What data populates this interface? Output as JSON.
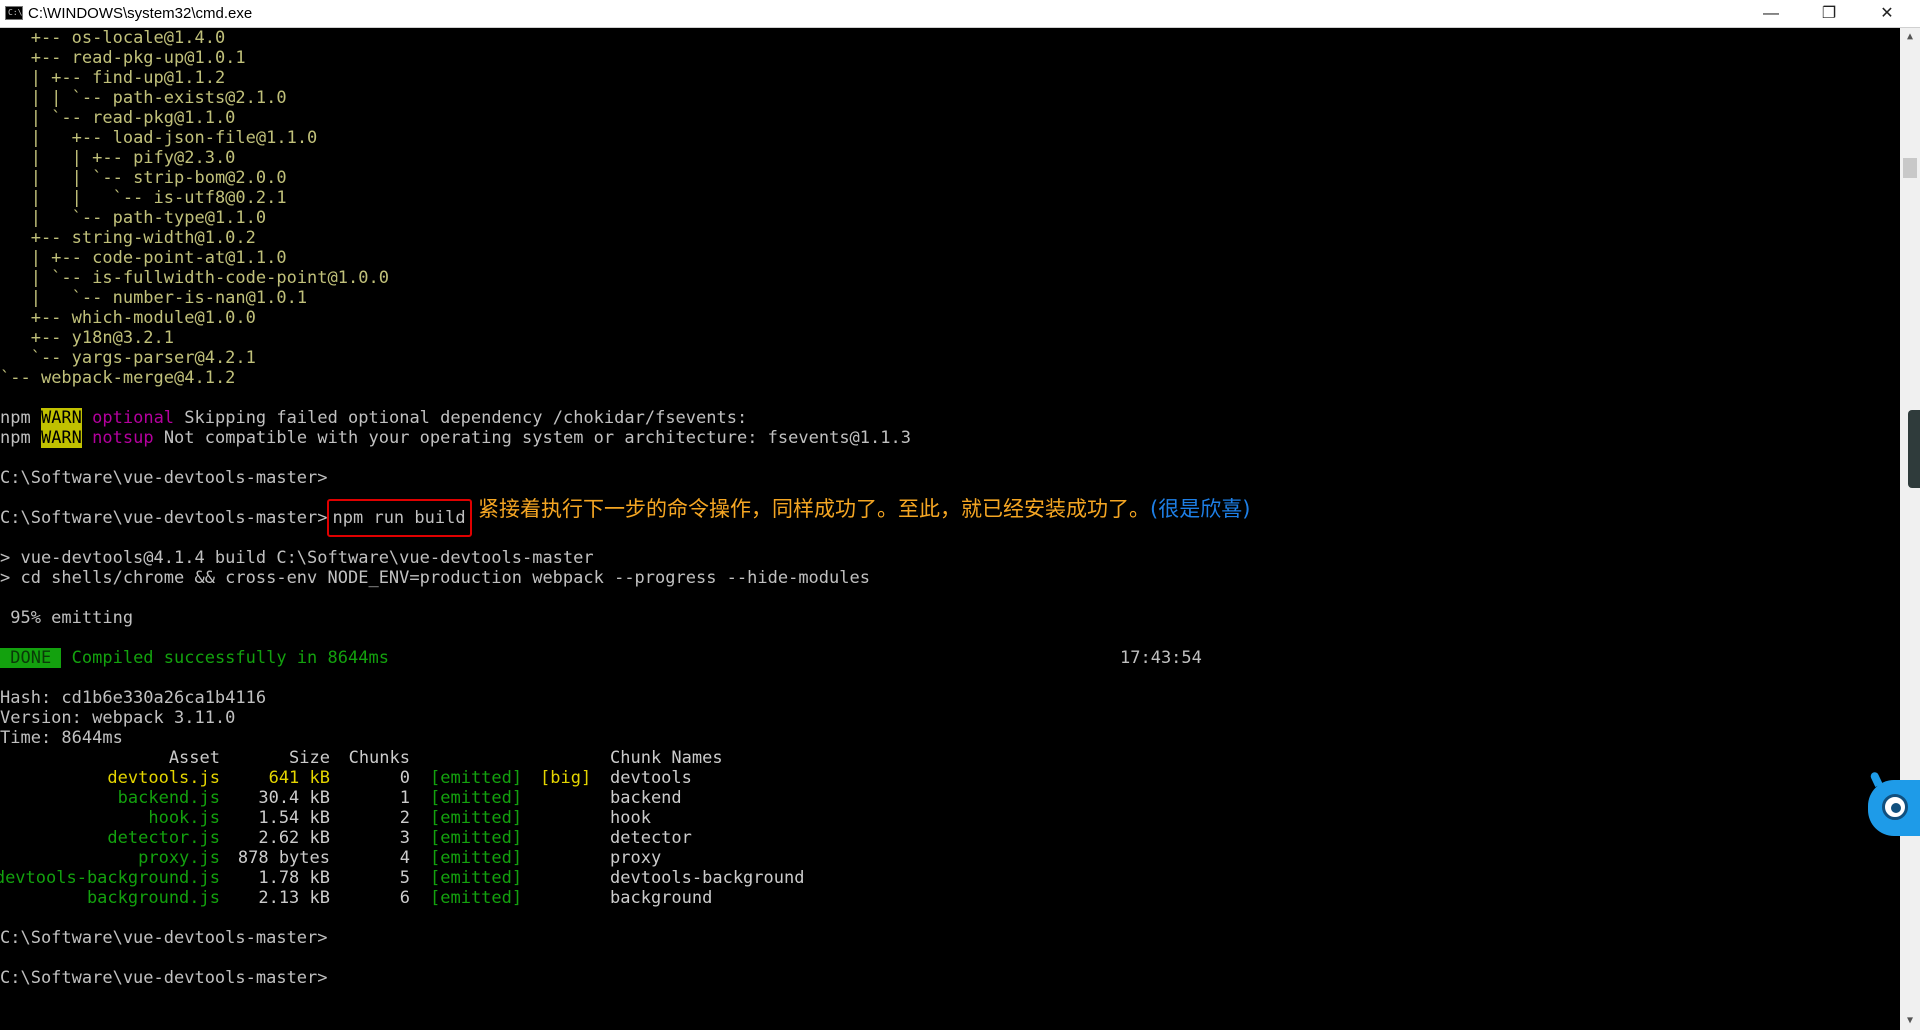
{
  "window": {
    "title": "C:\\WINDOWS\\system32\\cmd.exe",
    "icon_text": "C:\\",
    "minimize": "—",
    "maximize": "❐",
    "close": "✕"
  },
  "tree": [
    {
      "prefix": "   +-- ",
      "pkg": "os-locale@1.4.0"
    },
    {
      "prefix": "   +-- ",
      "pkg": "read-pkg-up@1.0.1"
    },
    {
      "prefix": "   | +-- ",
      "pkg": "find-up@1.1.2"
    },
    {
      "prefix": "   | | `-- ",
      "pkg": "path-exists@2.1.0"
    },
    {
      "prefix": "   | `-- ",
      "pkg": "read-pkg@1.1.0"
    },
    {
      "prefix": "   |   +-- ",
      "pkg": "load-json-file@1.1.0"
    },
    {
      "prefix": "   |   | +-- ",
      "pkg": "pify@2.3.0"
    },
    {
      "prefix": "   |   | `-- ",
      "pkg": "strip-bom@2.0.0"
    },
    {
      "prefix": "   |   |   `-- ",
      "pkg": "is-utf8@0.2.1"
    },
    {
      "prefix": "   |   `-- ",
      "pkg": "path-type@1.1.0"
    },
    {
      "prefix": "   +-- ",
      "pkg": "string-width@1.0.2"
    },
    {
      "prefix": "   | +-- ",
      "pkg": "code-point-at@1.1.0"
    },
    {
      "prefix": "   | `-- ",
      "pkg": "is-fullwidth-code-point@1.0.0"
    },
    {
      "prefix": "   |   `-- ",
      "pkg": "number-is-nan@1.0.1"
    },
    {
      "prefix": "   +-- ",
      "pkg": "which-module@1.0.0"
    },
    {
      "prefix": "   +-- ",
      "pkg": "y18n@3.2.1"
    },
    {
      "prefix": "   `-- ",
      "pkg": "yargs-parser@4.2.1"
    },
    {
      "prefix": "`-- ",
      "pkg": "webpack-merge@4.1.2"
    }
  ],
  "warn1": {
    "npm": "npm ",
    "level": "WARN",
    "code": "optional",
    "msg": " Skipping failed optional dependency /chokidar/fsevents:"
  },
  "warn2": {
    "npm": "npm ",
    "level": "WARN",
    "code": "notsup",
    "msg": " Not compatible with your operating system or architecture: fsevents@1.1.3"
  },
  "prompt": "C:\\Software\\vue-devtools-master>",
  "command": "npm run build",
  "annotation": {
    "main": "紧接着执行下一步的命令操作，同样成功了。至此，就已经安装成功了。",
    "aside": "(很是欣喜)"
  },
  "script1": "> vue-devtools@4.1.4 build C:\\Software\\vue-devtools-master",
  "script2": "> cd shells/chrome && cross-env NODE_ENV=production webpack --progress --hide-modules",
  "progress": " 95% emitting",
  "done": {
    "badge": " DONE ",
    "msg": " Compiled successfully in 8644ms",
    "time": "17:43:54"
  },
  "hash": "Hash: cd1b6e330a26ca1b4116",
  "version": "Version: webpack 3.11.0",
  "time": "Time: 8644ms",
  "table": {
    "headers": [
      "Asset",
      "Size",
      "Chunks",
      "Chunk Names"
    ],
    "rows": [
      {
        "asset": "devtools.js",
        "size": "641 kB",
        "chunk": "0",
        "status": "[emitted]",
        "flag": "[big]",
        "name": "devtools"
      },
      {
        "asset": "backend.js",
        "size": "30.4 kB",
        "chunk": "1",
        "status": "[emitted]",
        "flag": "",
        "name": "backend"
      },
      {
        "asset": "hook.js",
        "size": "1.54 kB",
        "chunk": "2",
        "status": "[emitted]",
        "flag": "",
        "name": "hook"
      },
      {
        "asset": "detector.js",
        "size": "2.62 kB",
        "chunk": "3",
        "status": "[emitted]",
        "flag": "",
        "name": "detector"
      },
      {
        "asset": "proxy.js",
        "size": "878 bytes",
        "chunk": "4",
        "status": "[emitted]",
        "flag": "",
        "name": "proxy"
      },
      {
        "asset": "devtools-background.js",
        "size": "1.78 kB",
        "chunk": "5",
        "status": "[emitted]",
        "flag": "",
        "name": "devtools-background"
      },
      {
        "asset": "background.js",
        "size": "2.13 kB",
        "chunk": "6",
        "status": "[emitted]",
        "flag": "",
        "name": "background"
      }
    ]
  },
  "colors": {
    "yellow": "#c0c07a",
    "green": "#13a10e",
    "magenta": "#b4009e",
    "highlight": "#e00000"
  }
}
